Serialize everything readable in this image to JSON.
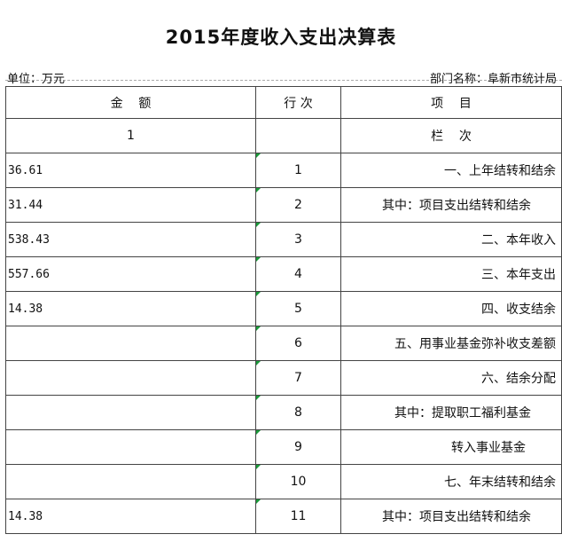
{
  "title": "2015年度收入支出决算表",
  "unit_label": "单位：万元",
  "dept_label": "部门名称：阜新市统计局",
  "headers": {
    "amount": "金    额",
    "row_no": "行 次",
    "item": "项    目"
  },
  "col_index_row": {
    "amount": "1",
    "row_no": "",
    "item": "栏    次"
  },
  "rows": [
    {
      "amount": "36.61",
      "row_no": "1",
      "item": "一、上年结转和结余"
    },
    {
      "amount": "31.44",
      "row_no": "2",
      "item": "其中：项目支出结转和结余"
    },
    {
      "amount": "538.43",
      "row_no": "3",
      "item": "二、本年收入"
    },
    {
      "amount": "557.66",
      "row_no": "4",
      "item": "三、本年支出"
    },
    {
      "amount": "14.38",
      "row_no": "5",
      "item": "四、收支结余"
    },
    {
      "amount": "",
      "row_no": "6",
      "item": "五、用事业基金弥补收支差额"
    },
    {
      "amount": "",
      "row_no": "7",
      "item": "六、结余分配"
    },
    {
      "amount": "",
      "row_no": "8",
      "item": "其中：提取职工福利基金"
    },
    {
      "amount": "",
      "row_no": "9",
      "item": "转入事业基金"
    },
    {
      "amount": "",
      "row_no": "10",
      "item": "七、年末结转和结余"
    },
    {
      "amount": "14.38",
      "row_no": "11",
      "item": "其中：项目支出结转和结余"
    }
  ]
}
